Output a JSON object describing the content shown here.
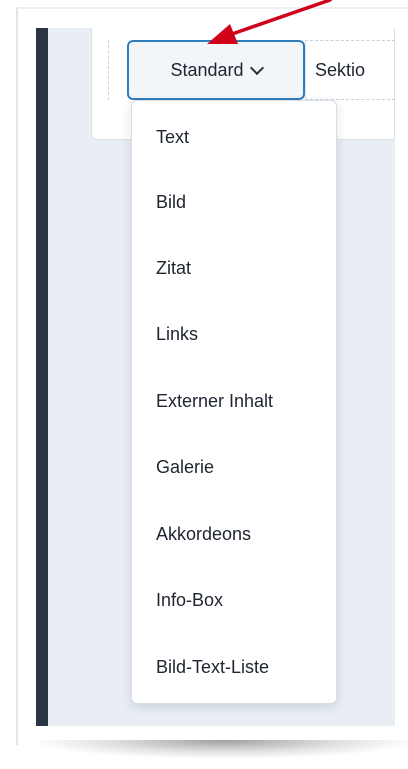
{
  "toolbar": {
    "active_tab_label": "Standard",
    "next_tab_label": "Sektio"
  },
  "dropdown": {
    "items": [
      {
        "label": "Text"
      },
      {
        "label": "Bild"
      },
      {
        "label": "Zitat"
      },
      {
        "label": "Links"
      },
      {
        "label": "Externer Inhalt"
      },
      {
        "label": "Galerie"
      },
      {
        "label": "Akkordeons"
      },
      {
        "label": "Info-Box"
      },
      {
        "label": "Bild-Text-Liste"
      }
    ]
  },
  "annotation": {
    "arrow_color": "#d0021b",
    "icon": "arrow-pointer-icon"
  },
  "colors": {
    "accent": "#2f7fbf",
    "sidebar": "#2b3443",
    "canvas": "#e9eef5"
  }
}
